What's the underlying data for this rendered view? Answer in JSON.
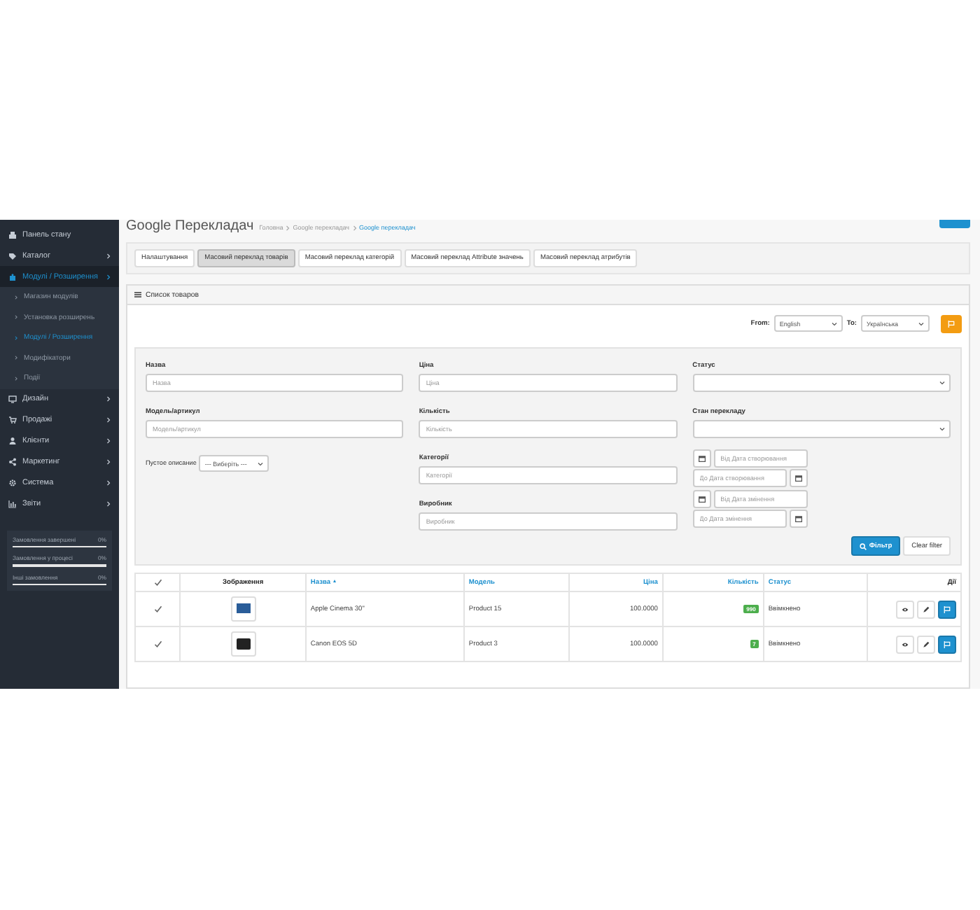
{
  "sidebar": {
    "items": [
      {
        "label": "Панель стану",
        "selected": false,
        "has_arrow": false
      },
      {
        "label": "Каталог",
        "selected": false,
        "has_arrow": true
      },
      {
        "label": "Модулі / Розширення",
        "selected": true,
        "has_arrow": true,
        "expanded": true,
        "children": [
          {
            "label": "Магазин модулів",
            "selected": false
          },
          {
            "label": "Установка розширень",
            "selected": false
          },
          {
            "label": "Модулі / Розширення",
            "selected": true
          },
          {
            "label": "Модифікатори",
            "selected": false
          },
          {
            "label": "Події",
            "selected": false
          }
        ]
      },
      {
        "label": "Дизайн",
        "selected": false,
        "has_arrow": true
      },
      {
        "label": "Продажі",
        "selected": false,
        "has_arrow": true
      },
      {
        "label": "Клієнти",
        "selected": false,
        "has_arrow": true
      },
      {
        "label": "Маркетинг",
        "selected": false,
        "has_arrow": true
      },
      {
        "label": "Система",
        "selected": false,
        "has_arrow": true
      },
      {
        "label": "Звіти",
        "selected": false,
        "has_arrow": true
      }
    ],
    "stats": [
      {
        "label": "Замовлення завершені",
        "value": "0%",
        "level": 0
      },
      {
        "label": "Замовлення у процесі",
        "value": "0%",
        "level": 0
      },
      {
        "label": "Інші замовлення",
        "value": "0%",
        "level": 0
      }
    ]
  },
  "header": {
    "title": "Google Перекладач",
    "breadcrumbs": [
      {
        "label": "Головна",
        "current": false
      },
      {
        "label": "Google перекладач",
        "current": false
      },
      {
        "label": "Google перекладач",
        "current": true
      }
    ]
  },
  "tabs": [
    {
      "label": "Налаштування",
      "selected": false
    },
    {
      "label": "Масовий переклад товарів",
      "selected": true
    },
    {
      "label": "Масовий переклад категорій",
      "selected": false
    },
    {
      "label": "Масовий переклад Attribute значень",
      "selected": false
    },
    {
      "label": "Масовий переклад атрибутів",
      "selected": false
    }
  ],
  "panel": {
    "title": "Список товаров",
    "languages": {
      "from_label": "From:",
      "from_value": "English",
      "to_label": "To:",
      "to_value": "Українська"
    },
    "filter": {
      "columns": [
        [
          {
            "kind": "text",
            "label": "Назва",
            "placeholder": "Назва"
          },
          {
            "kind": "text",
            "label": "Модель/артикул",
            "placeholder": "Модель/артикул"
          },
          {
            "kind": "inline_select",
            "label": "Пустое описание",
            "value": "--- Виберіть ---"
          }
        ],
        [
          {
            "kind": "text",
            "label": "Ціна",
            "placeholder": "Ціна"
          },
          {
            "kind": "text",
            "label": "Кількість",
            "placeholder": "Кількість"
          },
          {
            "kind": "text",
            "label": "Категорії",
            "placeholder": "Категорії"
          },
          {
            "kind": "text",
            "label": "Виробник",
            "placeholder": "Виробник"
          }
        ],
        [
          {
            "kind": "select",
            "label": "Статус"
          },
          {
            "kind": "select",
            "label": "Стан перекладу"
          },
          {
            "kind": "date_range",
            "from_placeholder": "Від Дата створювання",
            "to_placeholder": "До Дата створювання"
          },
          {
            "kind": "date_range",
            "from_placeholder": "Від Дата змінення",
            "to_placeholder": "До Дата змінення"
          }
        ]
      ],
      "buttons": [
        {
          "label": "Фільтр",
          "kind": "primary"
        },
        {
          "label": "Clear filter",
          "kind": "default"
        }
      ]
    },
    "table": {
      "columns": [
        {
          "kind": "check",
          "checked": true
        },
        {
          "kind": "text",
          "label": "Зображення",
          "sortable": false
        },
        {
          "kind": "text",
          "label": "Назва",
          "sortable": true,
          "sorted": true
        },
        {
          "kind": "text",
          "label": "Модель",
          "sortable": true,
          "sorted": false
        },
        {
          "kind": "text",
          "label": "Ціна",
          "sortable": true,
          "sorted": false
        },
        {
          "kind": "text",
          "label": "Кількість",
          "sortable": true,
          "sorted": false
        },
        {
          "kind": "text",
          "label": "Статус",
          "sortable": true,
          "sorted": false
        },
        {
          "kind": "text",
          "label": "Дії",
          "sortable": false
        }
      ],
      "rows": [
        {
          "checked": true,
          "name": "Apple Cinema 30\"",
          "model": "Product 15",
          "price": "100.0000",
          "quantity": "990",
          "status": "Ввімкнено"
        },
        {
          "checked": true,
          "name": "Canon EOS 5D",
          "model": "Product 3",
          "price": "100.0000",
          "quantity": "7",
          "status": "Ввімкнено"
        }
      ]
    }
  }
}
